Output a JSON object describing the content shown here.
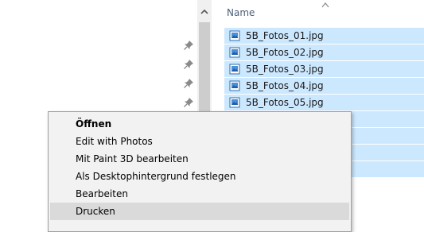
{
  "list": {
    "header": "Name",
    "files": [
      {
        "name": "5B_Fotos_01.jpg"
      },
      {
        "name": "5B_Fotos_02.jpg"
      },
      {
        "name": "5B_Fotos_03.jpg"
      },
      {
        "name": "5B_Fotos_04.jpg"
      },
      {
        "name": "5B_Fotos_05.jpg"
      }
    ],
    "selected_color": "#cce8ff",
    "icon": "image-file-icon"
  },
  "nav": {
    "pin_icon": "pin-icon"
  },
  "context_menu": {
    "items": [
      {
        "label": "Öffnen",
        "default": true
      },
      {
        "label": "Edit with Photos"
      },
      {
        "label": "Mit Paint 3D bearbeiten"
      },
      {
        "label": "Als Desktophintergrund festlegen"
      },
      {
        "label": "Bearbeiten"
      },
      {
        "label": "Drucken",
        "hovered": true
      }
    ]
  }
}
